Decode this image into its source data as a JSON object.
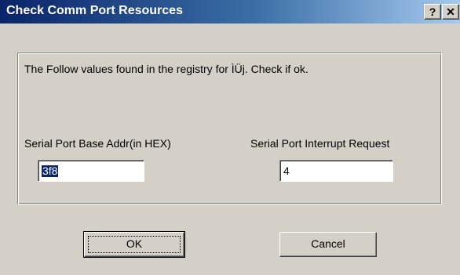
{
  "window": {
    "title": "Check Comm Port Resources",
    "help_label": "?",
    "close_label": "✕"
  },
  "dialog": {
    "message": "The Follow values found in the registry for ÌÜj. Check if ok.",
    "base_addr_label": "Serial Port Base Addr(in HEX)",
    "base_addr_value": "3f8",
    "irq_label": "Serial Port Interrupt Request",
    "irq_value": "4"
  },
  "buttons": {
    "ok_label": "OK",
    "cancel_label": "Cancel"
  },
  "colors": {
    "titlebar_start": "#0a246a",
    "face": "#d4d0c8",
    "selection": "#0a246a"
  }
}
